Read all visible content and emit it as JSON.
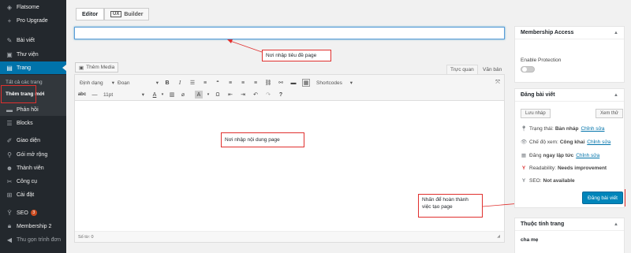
{
  "sidebar": {
    "items": [
      {
        "label": "Flatsome",
        "icon": "flatsome-icon"
      },
      {
        "label": "Pro Upgrade",
        "icon": "plus-icon"
      },
      {
        "label": "Bài viết",
        "icon": "pin-icon"
      },
      {
        "label": "Thư viện",
        "icon": "media-icon"
      },
      {
        "label": "Trang",
        "icon": "page-icon"
      },
      {
        "label": "Phản hồi",
        "icon": "comment-icon"
      },
      {
        "label": "Blocks",
        "icon": "blocks-icon"
      },
      {
        "label": "Giao diện",
        "icon": "brush-icon"
      },
      {
        "label": "Gói mở rộng",
        "icon": "plugin-icon"
      },
      {
        "label": "Thành viên",
        "icon": "user-icon"
      },
      {
        "label": "Công cụ",
        "icon": "wrench-icon"
      },
      {
        "label": "Cài đặt",
        "icon": "settings-icon"
      },
      {
        "label": "SEO",
        "icon": "yoast-icon",
        "badge": "3"
      },
      {
        "label": "Membership 2",
        "icon": "lock-icon"
      },
      {
        "label": "Thu gọn trình đơn",
        "icon": "collapse-icon"
      }
    ],
    "submenu": [
      "Tất cả các trang",
      "Thêm trang mới"
    ]
  },
  "tabs": {
    "editor": "Editor",
    "ux_badge": "UX",
    "builder": "Builder"
  },
  "title_input": {
    "value": ""
  },
  "media_button": "Thêm Media",
  "mode_tabs": {
    "visual": "Trực quan",
    "text": "Văn bản"
  },
  "toolbar": {
    "format_select": "Định dạng",
    "paragraph_select": "Đoạn",
    "shortcodes": "Shortcodes",
    "font_size": "11pt"
  },
  "status_bar": "Số từ: 0",
  "notes": {
    "title_note": "Nơi nhập tiêu đề page",
    "content_note": "Nơi nhập nội dung page",
    "publish_note": "Nhấn để hoàn thành việc tạo page"
  },
  "membership": {
    "title": "Membership Access",
    "enable_label": "Enable Protection"
  },
  "publish_box": {
    "title": "Đăng bài viết",
    "save_draft": "Lưu nháp",
    "preview": "Xem thử",
    "status_label": "Trạng thái:",
    "status_value": "Bản nháp",
    "visibility_label": "Chế độ xem:",
    "visibility_value": "Công khai",
    "schedule_label": "Đăng",
    "schedule_value": "ngay lập tức",
    "edit_link": "Chỉnh sửa",
    "readability_label": "Readability:",
    "readability_value": "Needs improvement",
    "seo_label": "SEO:",
    "seo_value": "Not available",
    "publish": "Đăng bài viết"
  },
  "attributes_box": {
    "title": "Thuộc tính trang",
    "parent_label": "cha mẹ"
  },
  "colors": {
    "sidebar": "#23282d",
    "active": "#0073aa",
    "annotation": "#e0302e",
    "publish": "#0085ba"
  }
}
